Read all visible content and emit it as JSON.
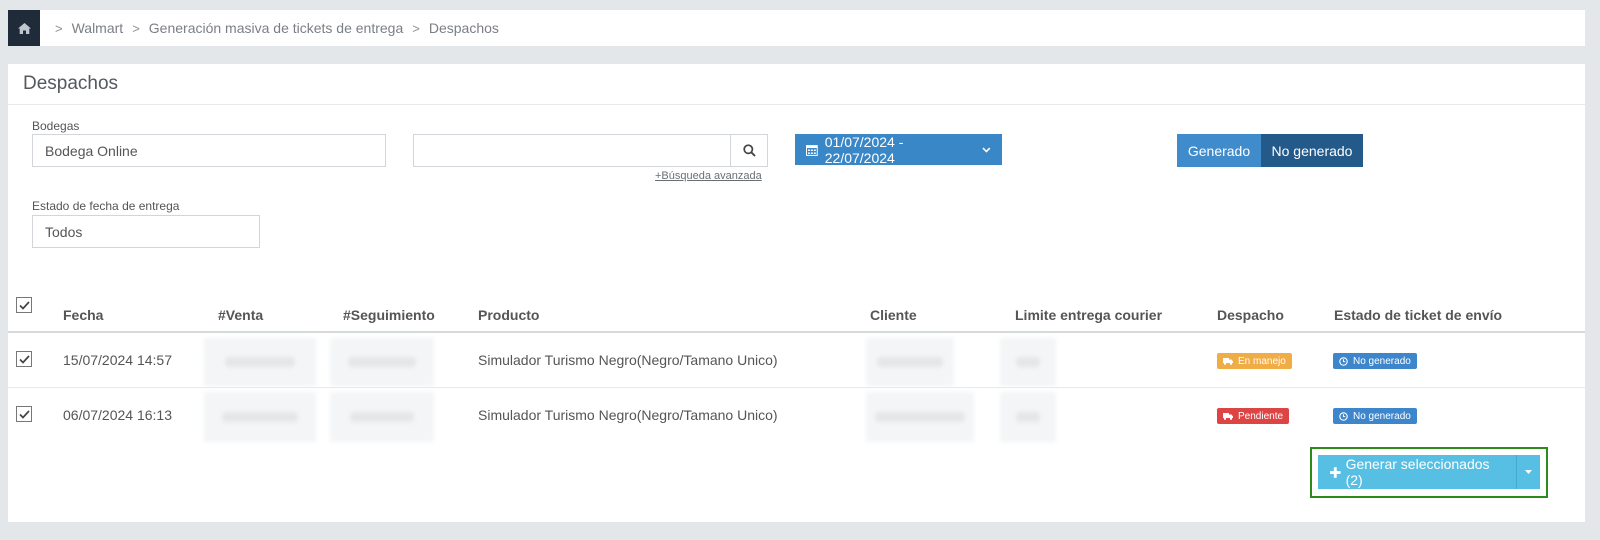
{
  "breadcrumb": {
    "items": [
      "Walmart",
      "Generación masiva de tickets de entrega",
      "Despachos"
    ],
    "separator": ">"
  },
  "page": {
    "title": "Despachos"
  },
  "filters": {
    "bodegas_label": "Bodegas",
    "bodegas_value": "Bodega Online",
    "search_value": "",
    "advanced_search": "+Búsqueda avanzada",
    "date_range": "01/07/2024 - 22/07/2024",
    "toggle": {
      "generado": "Generado",
      "no_generado": "No generado",
      "active": "No generado"
    },
    "estado_label": "Estado de fecha de entrega",
    "estado_value": "Todos"
  },
  "table": {
    "columns": [
      "Fecha",
      "#Venta",
      "#Seguimiento",
      "Producto",
      "Cliente",
      "Limite entrega courier",
      "Despacho",
      "Estado de ticket de envío"
    ],
    "rows": [
      {
        "checked": true,
        "fecha": "15/07/2024 14:57",
        "producto": "Simulador Turismo Negro(Negro/Tamano Unico)",
        "despacho": "En manejo",
        "estado_ticket": "No generado"
      },
      {
        "checked": true,
        "fecha": "06/07/2024 16:13",
        "producto": "Simulador Turismo Negro(Negro/Tamano Unico)",
        "despacho": "Pendiente",
        "estado_ticket": "No generado"
      }
    ]
  },
  "actions": {
    "generate_selected": "Generar seleccionados (2)"
  },
  "colors": {
    "primary": "#3a87c8",
    "dark_toggle": "#235a8a",
    "info_button": "#57bfe3",
    "badge_orange": "#f0ac45",
    "badge_red": "#dd4545",
    "badge_blue": "#3d86cb",
    "highlight": "#2d8b1c"
  },
  "icons": [
    "home-icon",
    "search-icon",
    "calendar-icon",
    "chevron-down-icon",
    "truck-icon",
    "clock-icon",
    "plus-icon",
    "caret-down-icon",
    "check-icon"
  ]
}
